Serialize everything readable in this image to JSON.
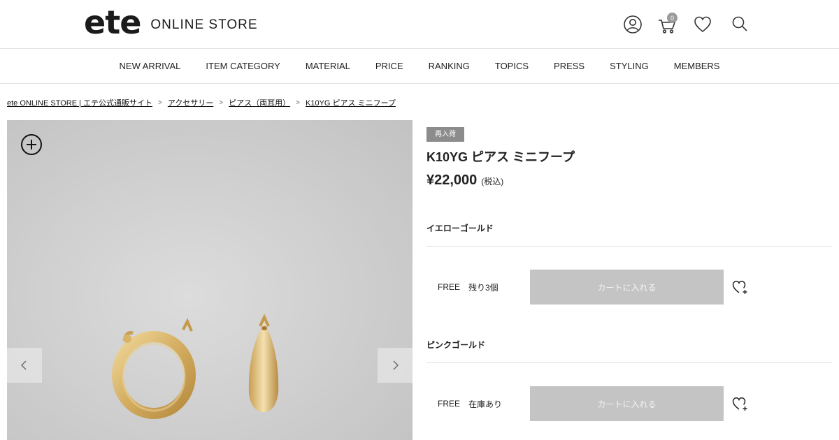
{
  "header": {
    "logo_mark": "ete",
    "logo_sub": "ONLINE STORE",
    "cart_count": "0"
  },
  "nav": {
    "items": [
      "NEW ARRIVAL",
      "ITEM CATEGORY",
      "MATERIAL",
      "PRICE",
      "RANKING",
      "TOPICS",
      "PRESS",
      "STYLING",
      "MEMBERS"
    ]
  },
  "breadcrumb": {
    "items": [
      "ete ONLINE STORE | エテ公式通販サイト",
      "アクセサリー",
      "ピアス（両耳用）",
      "K10YG ピアス ミニフープ"
    ],
    "separator": ">"
  },
  "product": {
    "badge": "再入荷",
    "title": "K10YG ピアス ミニフープ",
    "price": "¥22,000",
    "tax_label": "(税込)"
  },
  "variants": [
    {
      "color": "イエローゴールド",
      "size": "FREE",
      "stock": "残り3個",
      "button": "カートに入れる"
    },
    {
      "color": "ピンクゴールド",
      "size": "FREE",
      "stock": "在庫あり",
      "button": "カートに入れる"
    }
  ],
  "colors": {
    "badge_bg": "#8c8c8c",
    "cart_button_bg": "#c4c4c4",
    "gold": "#d9b56a"
  }
}
